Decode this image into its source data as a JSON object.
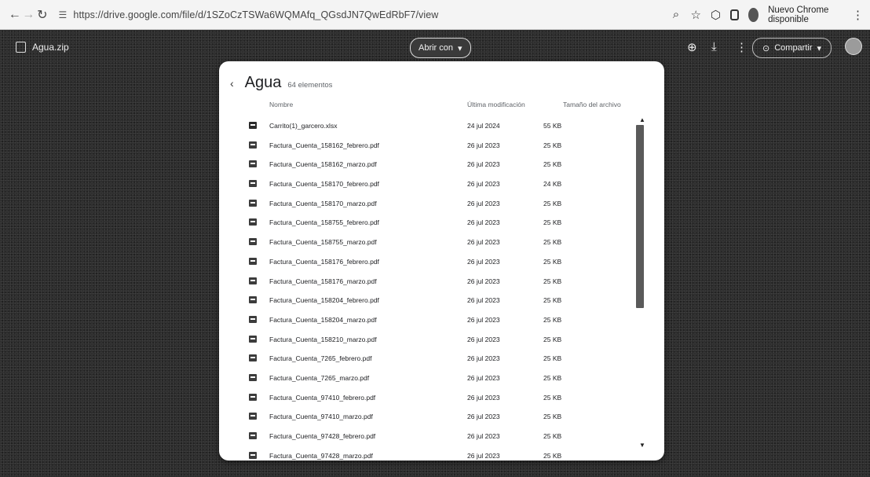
{
  "browser": {
    "url": "https://drive.google.com/file/d/1SZoCzTSWa6WQMAfq_QGsdJN7QwEdRbF7/view",
    "update_label": "Nuevo Chrome disponible"
  },
  "viewer": {
    "filename": "Agua.zip",
    "open_with_label": "Abrir con",
    "share_label": "Compartir"
  },
  "panel": {
    "title": "Agua",
    "count": "64 elementos",
    "columns": {
      "name": "Nombre",
      "modified": "Última modificación",
      "size": "Tamaño del archivo"
    },
    "files": [
      {
        "name": "Carrito(1)_garcero.xlsx",
        "date": "24 jul 2024",
        "size": "55 KB"
      },
      {
        "name": "Factura_Cuenta_158162_febrero.pdf",
        "date": "26 jul 2023",
        "size": "25 KB"
      },
      {
        "name": "Factura_Cuenta_158162_marzo.pdf",
        "date": "26 jul 2023",
        "size": "25 KB"
      },
      {
        "name": "Factura_Cuenta_158170_febrero.pdf",
        "date": "26 jul 2023",
        "size": "24 KB"
      },
      {
        "name": "Factura_Cuenta_158170_marzo.pdf",
        "date": "26 jul 2023",
        "size": "25 KB"
      },
      {
        "name": "Factura_Cuenta_158755_febrero.pdf",
        "date": "26 jul 2023",
        "size": "25 KB"
      },
      {
        "name": "Factura_Cuenta_158755_marzo.pdf",
        "date": "26 jul 2023",
        "size": "25 KB"
      },
      {
        "name": "Factura_Cuenta_158176_febrero.pdf",
        "date": "26 jul 2023",
        "size": "25 KB"
      },
      {
        "name": "Factura_Cuenta_158176_marzo.pdf",
        "date": "26 jul 2023",
        "size": "25 KB"
      },
      {
        "name": "Factura_Cuenta_158204_febrero.pdf",
        "date": "26 jul 2023",
        "size": "25 KB"
      },
      {
        "name": "Factura_Cuenta_158204_marzo.pdf",
        "date": "26 jul 2023",
        "size": "25 KB"
      },
      {
        "name": "Factura_Cuenta_158210_marzo.pdf",
        "date": "26 jul 2023",
        "size": "25 KB"
      },
      {
        "name": "Factura_Cuenta_7265_febrero.pdf",
        "date": "26 jul 2023",
        "size": "25 KB"
      },
      {
        "name": "Factura_Cuenta_7265_marzo.pdf",
        "date": "26 jul 2023",
        "size": "25 KB"
      },
      {
        "name": "Factura_Cuenta_97410_febrero.pdf",
        "date": "26 jul 2023",
        "size": "25 KB"
      },
      {
        "name": "Factura_Cuenta_97410_marzo.pdf",
        "date": "26 jul 2023",
        "size": "25 KB"
      },
      {
        "name": "Factura_Cuenta_97428_febrero.pdf",
        "date": "26 jul 2023",
        "size": "25 KB"
      },
      {
        "name": "Factura_Cuenta_97428_marzo.pdf",
        "date": "26 jul 2023",
        "size": "25 KB"
      }
    ]
  }
}
